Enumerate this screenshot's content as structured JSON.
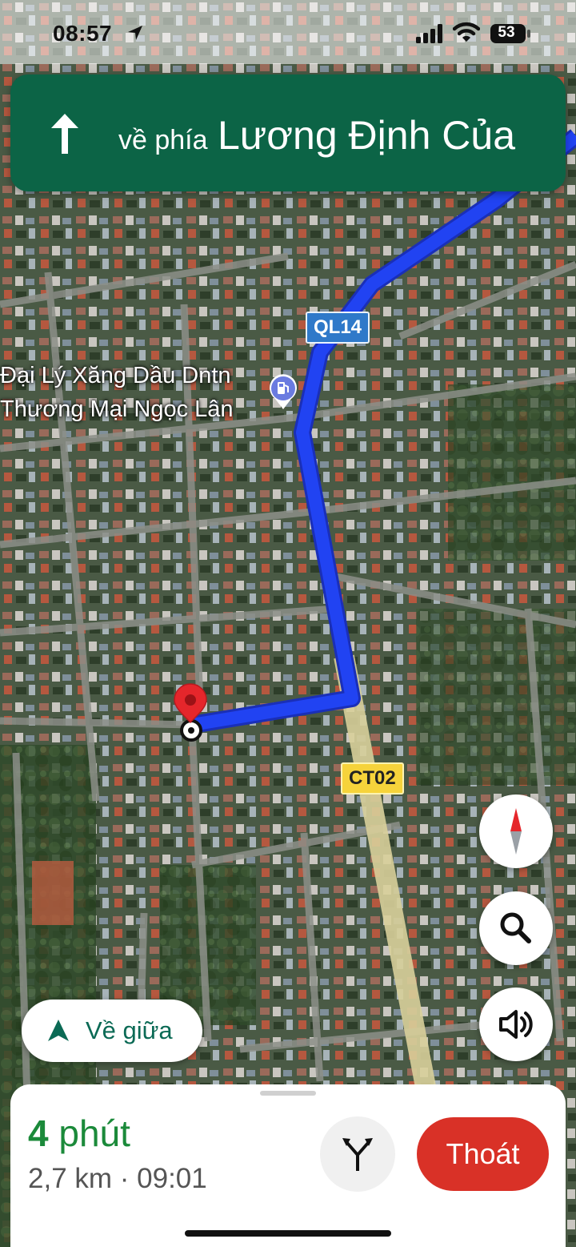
{
  "status_bar": {
    "time": "08:57",
    "battery": "53"
  },
  "navigation": {
    "direction_prefix": "về phía",
    "street": "Lương Định Của",
    "icon": "arrow-up-icon"
  },
  "map": {
    "road_labels": [
      {
        "text": "QL14",
        "color": "#2f79c9"
      },
      {
        "text": "CT02",
        "color": "#f6d33b"
      }
    ],
    "poi": {
      "line1": "Đại Lý Xăng Dầu Dntn",
      "line2": "Thương Mại Ngọc Lân",
      "icon": "gas-station-icon"
    },
    "route_color": "#1f3ff0",
    "destination_marker_color": "#e5262b"
  },
  "controls": {
    "recenter_label": "Về giữa",
    "compass_icon": "compass-icon",
    "search_icon": "search-icon",
    "sound_icon": "volume-icon"
  },
  "trip": {
    "duration_value": "4",
    "duration_unit": "phút",
    "details": "2,7 km · 09:01",
    "alternate_routes_icon": "alt-routes-icon",
    "exit_label": "Thoát",
    "exit_color": "#d93127"
  }
}
